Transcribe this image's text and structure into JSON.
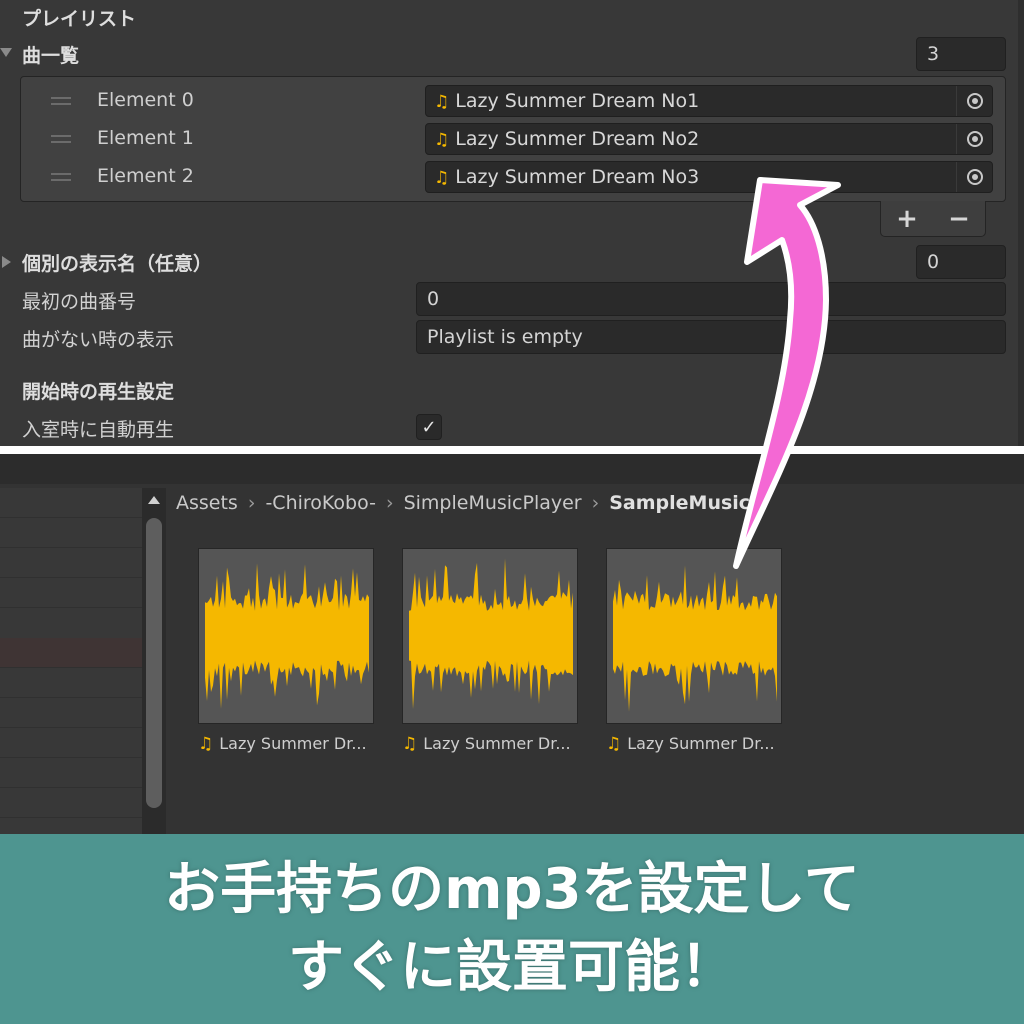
{
  "inspector": {
    "section_playlist": "プレイリスト",
    "songs": {
      "label": "曲一覧",
      "count": "3",
      "elements": [
        {
          "label": "Element 0",
          "value": "Lazy Summer Dream No1"
        },
        {
          "label": "Element 1",
          "value": "Lazy Summer Dream No2"
        },
        {
          "label": "Element 2",
          "value": "Lazy Summer Dream No3"
        }
      ],
      "add_label": "+",
      "remove_label": "−"
    },
    "display_names": {
      "label": "個別の表示名（任意）",
      "count": "0"
    },
    "first_track": {
      "label": "最初の曲番号",
      "value": "0"
    },
    "empty_text": {
      "label": "曲がない時の表示",
      "value": "Playlist is empty"
    },
    "section_playback": "開始時の再生設定",
    "autoplay": {
      "label": "入室時に自動再生",
      "checked": true,
      "check_glyph": "✓"
    }
  },
  "project": {
    "breadcrumb": [
      "Assets",
      "-ChiroKobo-",
      "SimpleMusicPlayer",
      "SampleMusic"
    ],
    "assets": [
      {
        "label": "Lazy Summer Dr..."
      },
      {
        "label": "Lazy Summer Dr..."
      },
      {
        "label": "Lazy Summer Dr..."
      }
    ]
  },
  "banner": {
    "line1": "お手持ちのmp3を設定して",
    "line2": "すぐに設置可能！"
  },
  "colors": {
    "waveform": "#f5b800",
    "arrow": "#f468d4",
    "banner": "#4e9590",
    "note_icon": "#f5b800"
  },
  "icons": {
    "audio_clip": "music-note-icon",
    "object_picker": "object-picker-icon",
    "drag_handle": "drag-handle-icon"
  }
}
